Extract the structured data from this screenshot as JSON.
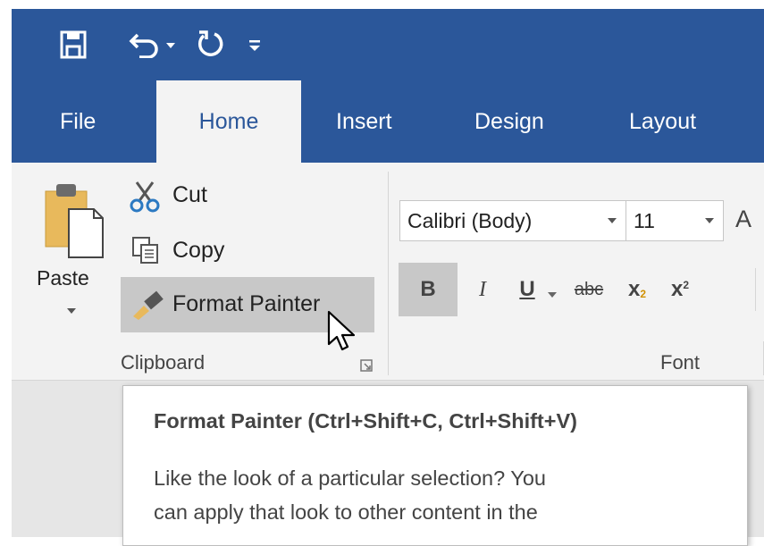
{
  "quick_access": {
    "icons": [
      "save-icon",
      "undo-icon",
      "dropdown-arrow-icon",
      "redo-icon",
      "customize-qat-icon"
    ]
  },
  "tabs": [
    {
      "label": "File"
    },
    {
      "label": "Home"
    },
    {
      "label": "Insert"
    },
    {
      "label": "Design"
    },
    {
      "label": "Layout"
    }
  ],
  "clipboard": {
    "paste_label": "Paste",
    "cut_label": "Cut",
    "copy_label": "Copy",
    "format_painter_label": "Format Painter",
    "group_label": "Clipboard"
  },
  "font": {
    "font_name": "Calibri (Body)",
    "font_size": "11",
    "grow_font_glyph": "A",
    "bold": "B",
    "italic": "I",
    "underline": "U",
    "strikethrough": "abc",
    "subscript": "x",
    "subscript_mark": "2",
    "superscript": "x",
    "superscript_mark": "2",
    "group_label": "Font"
  },
  "tooltip": {
    "title": "Format Painter (Ctrl+Shift+C, Ctrl+Shift+V)",
    "line1": "Like the look of a particular selection? You",
    "line2": "can apply that look to other content in the"
  },
  "colors": {
    "brand_blue": "#2b579a",
    "ribbon_bg": "#f3f3f3",
    "hover_bg": "#c8c8c8"
  }
}
